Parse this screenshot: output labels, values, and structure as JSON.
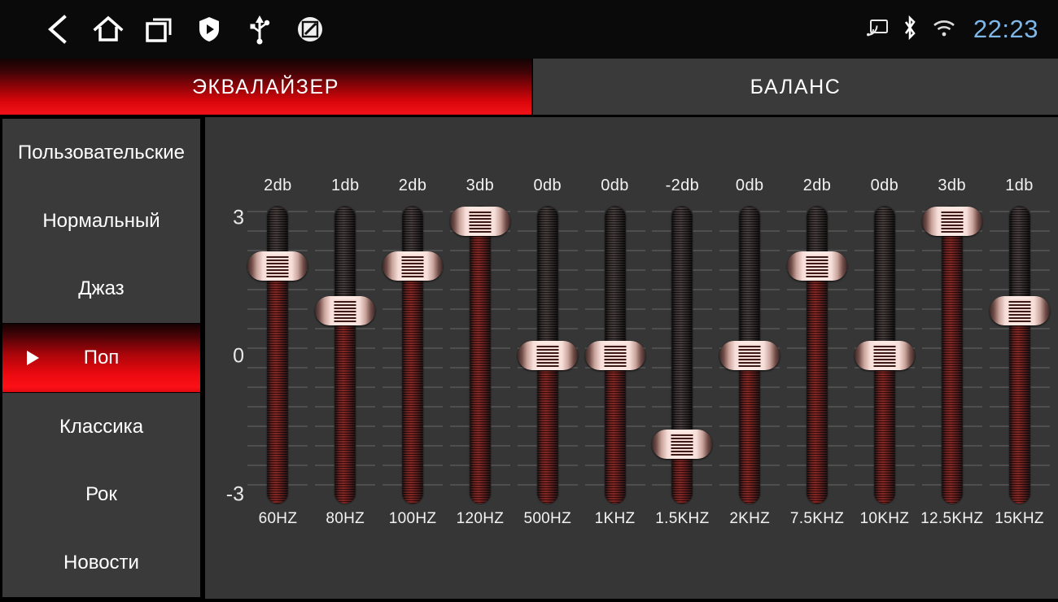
{
  "statusbar": {
    "nav_icons": [
      {
        "name": "back-icon",
        "glyph": "back"
      },
      {
        "name": "home-icon",
        "glyph": "home"
      },
      {
        "name": "recents-icon",
        "glyph": "recents"
      },
      {
        "name": "shield-icon",
        "glyph": "shield"
      },
      {
        "name": "usb-icon",
        "glyph": "usb"
      },
      {
        "name": "screenshot-edit-icon",
        "glyph": "edit"
      }
    ],
    "system_icons": [
      {
        "name": "cast-icon",
        "glyph": "cast"
      },
      {
        "name": "bluetooth-icon",
        "glyph": "bluetooth"
      },
      {
        "name": "wifi-icon",
        "glyph": "wifi"
      }
    ],
    "time": "22:23",
    "time_color": "#7fb7e8"
  },
  "tabs": [
    {
      "label": "ЭКВАЛАЙЗЕР",
      "active": true,
      "accent": "#e8090f"
    },
    {
      "label": "БАЛАНС",
      "active": false,
      "accent": "#3a3a3a"
    }
  ],
  "presets": [
    {
      "label": "Пользовательские",
      "selected": false
    },
    {
      "label": "Нормальный",
      "selected": false
    },
    {
      "label": "Джаз",
      "selected": false
    },
    {
      "label": "Поп",
      "selected": true
    },
    {
      "label": "Классика",
      "selected": false
    },
    {
      "label": "Рок",
      "selected": false
    },
    {
      "label": "Новости",
      "selected": false
    }
  ],
  "equalizer": {
    "axis_labels": {
      "top": "3",
      "mid": "0",
      "bottom": "-3"
    },
    "range": [
      -3,
      3
    ],
    "unit": "db"
  },
  "chart_data": {
    "type": "bar",
    "title": "ЭКВАЛАЙЗЕР",
    "xlabel": "",
    "ylabel": "db",
    "ylim": [
      -3,
      3
    ],
    "grid": true,
    "legend": "none",
    "categories": [
      "60HZ",
      "80HZ",
      "100HZ",
      "120HZ",
      "500HZ",
      "1KHZ",
      "1.5KHZ",
      "2KHZ",
      "7.5KHZ",
      "10KHZ",
      "12.5KHZ",
      "15KHZ"
    ],
    "values": [
      2,
      1,
      2,
      3,
      0,
      0,
      -2,
      0,
      2,
      0,
      3,
      1
    ],
    "value_labels": [
      "2db",
      "1db",
      "2db",
      "3db",
      "0db",
      "0db",
      "-2db",
      "0db",
      "2db",
      "0db",
      "3db",
      "1db"
    ],
    "tick_labels": [
      "3",
      "0",
      "-3"
    ]
  }
}
